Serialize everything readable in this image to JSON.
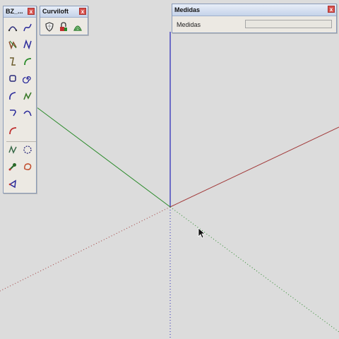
{
  "bz_toolbar": {
    "title": "BZ_...",
    "close_label": "x",
    "tools": [
      "arc-bezier-tool",
      "curve-bezier-tool",
      "spline-tool",
      "polyline-tool",
      "step-curve-tool",
      "fillet-arc-tool",
      "rounded-rect-tool",
      "spiral-tool",
      "arc-tool",
      "zigzag-tool",
      "corner-tool",
      "bend-tool",
      "red-arc-tool",
      "freehand-tool",
      "circle-dotted-tool",
      "settings-tool",
      "blob-tool",
      "shape-tool"
    ]
  },
  "curviloft_toolbar": {
    "title": "Curviloft",
    "close_label": "x",
    "tools": [
      "loft-shield-tool",
      "loft-lock-tool",
      "loft-skin-tool"
    ]
  },
  "medidas_panel": {
    "title": "Medidas",
    "close_label": "x",
    "label": "Medidas",
    "value": ""
  },
  "colors": {
    "axis_blue": "#2323b8",
    "axis_red": "#a23b3b",
    "axis_green": "#2a8a2a",
    "background": "#dcdcdc"
  }
}
